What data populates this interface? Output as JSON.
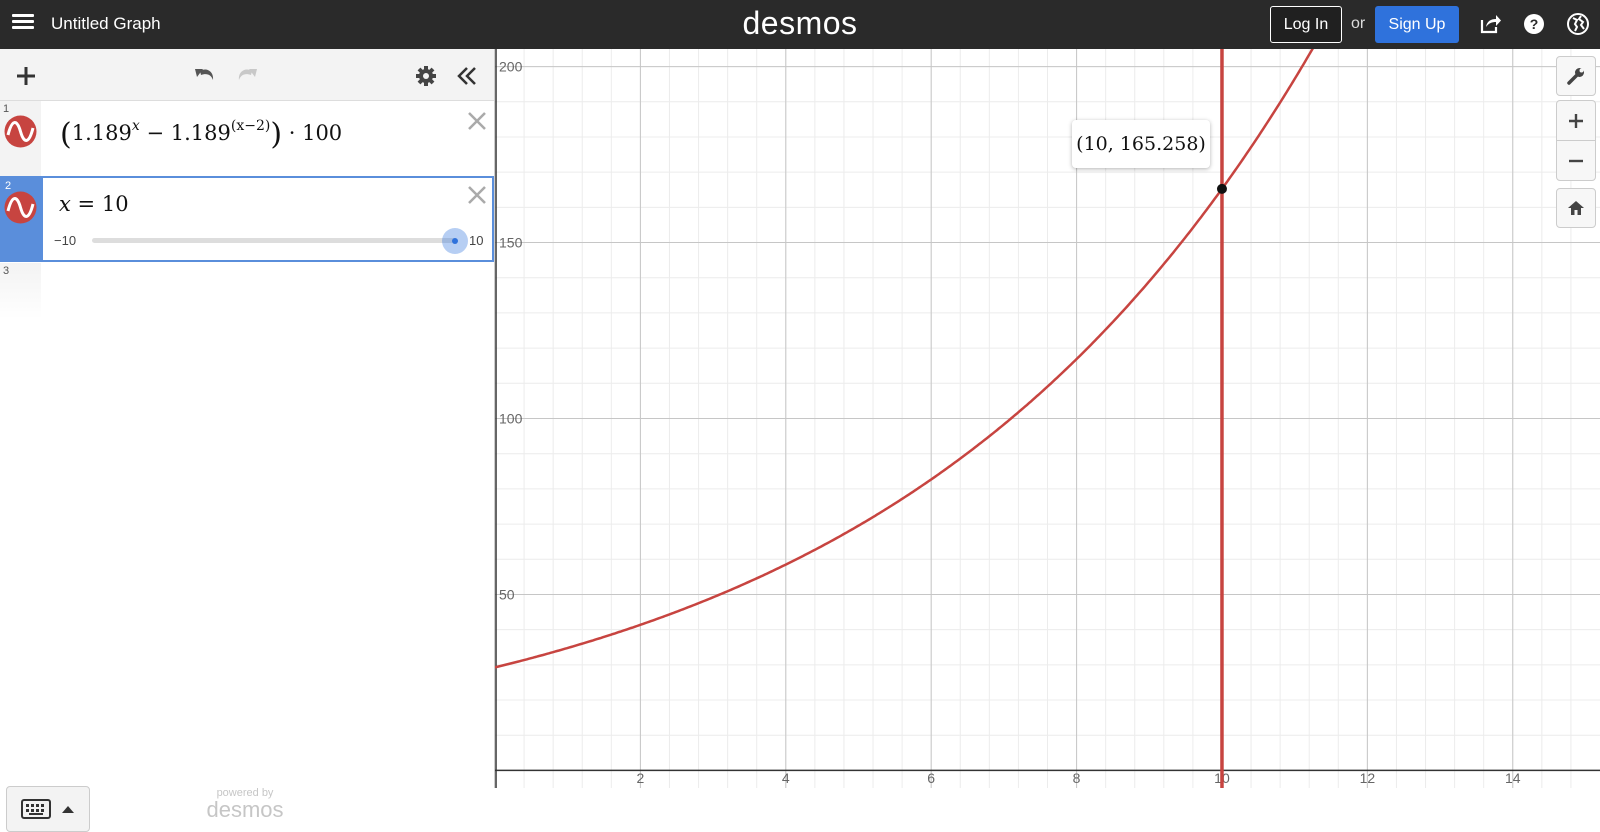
{
  "app": {
    "title": "Untitled Graph",
    "brand": "desmos"
  },
  "header": {
    "login_label": "Log In",
    "or_label": "or",
    "signup_label": "Sign Up"
  },
  "colors": {
    "topbar": "#2a2a2a",
    "signup": "#2f72dc",
    "curve": "#c74440",
    "active": "#5a8edb"
  },
  "expressions": [
    {
      "num": "1",
      "icon": "curve-icon",
      "base1": "1.189",
      "exp1": "x",
      "minus": "−",
      "base2": "1.189",
      "exp2": "(x−2)",
      "mult": "· 100"
    },
    {
      "num": "2",
      "icon": "curve-icon",
      "lhs": "x",
      "eq": "=",
      "rhs": "10",
      "slider": {
        "min_label": "−10",
        "max_label": "10",
        "value": 10,
        "min": -10,
        "max": 10
      }
    },
    {
      "num": "3"
    }
  ],
  "footer": {
    "powered_by": "powered by",
    "brand": "desmos"
  },
  "graph": {
    "tooltip": "(10, 165.258)",
    "x_ticks": [
      "2",
      "4",
      "6",
      "8",
      "10",
      "12",
      "14"
    ],
    "y_ticks": [
      "200",
      "150",
      "100",
      "50"
    ],
    "point": {
      "x": 10,
      "y": 165.258
    },
    "vertical_line_x": 10,
    "x_range": [
      0,
      15.2
    ],
    "y_range": [
      -5,
      205
    ]
  }
}
